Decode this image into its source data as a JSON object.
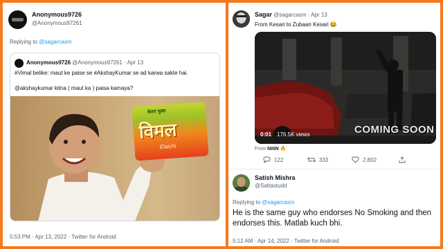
{
  "left_tweet": {
    "user_name": "Anonymous9726",
    "user_handle": "@Anonymous97261",
    "replying_prefix": "Replying to ",
    "replying_to": "@sagarcasm",
    "quoted": {
      "user_name": "Anonymous9726",
      "user_handle": "@Anonymous97261",
      "date": "· Apr 13",
      "text_line1": "#Vimal belike: maut ke paise se #AkshayKumar se ad karwa sakte hai.",
      "text_line2": "@akshaykumar  kitna ( maut ka ) paisa kamaya?",
      "packet_top": "केसर युक्त",
      "packet_brand": "विमल",
      "packet_sub": "Elaichi"
    },
    "footer": "5:53 PM · Apr 13, 2022 · Twitter for Android"
  },
  "right_tweet": {
    "user_name": "Sagar",
    "user_handle": "@sagarcasm",
    "date": "· Apr 13",
    "text": "From Kesari to Zubaan Kesari 😂",
    "video": {
      "time": "0:01",
      "views": "176.5K views",
      "overlay": "COMING SOON"
    },
    "from_prefix": "From ",
    "from_name": "NitiN 🔥",
    "reply_count": "122",
    "retweet_count": "333",
    "like_count": "2,802",
    "icons": {
      "reply": "reply-icon",
      "retweet": "retweet-icon",
      "like": "heart-icon",
      "share": "share-icon"
    }
  },
  "reply_tweet": {
    "user_name": "Satish Mishra",
    "user_handle": "@Sattastudd",
    "replying_prefix": "Replying to ",
    "replying_to": "@sagarcasm",
    "body": "He is the same guy who endorses No Smoking and then endorses this. Matlab kuch bhi.",
    "footer": "5:12 AM · Apr 14, 2022 · Twitter for Android"
  },
  "colors": {
    "frame": "#f47a1f",
    "link": "#1d9bf0",
    "muted": "#536471"
  }
}
